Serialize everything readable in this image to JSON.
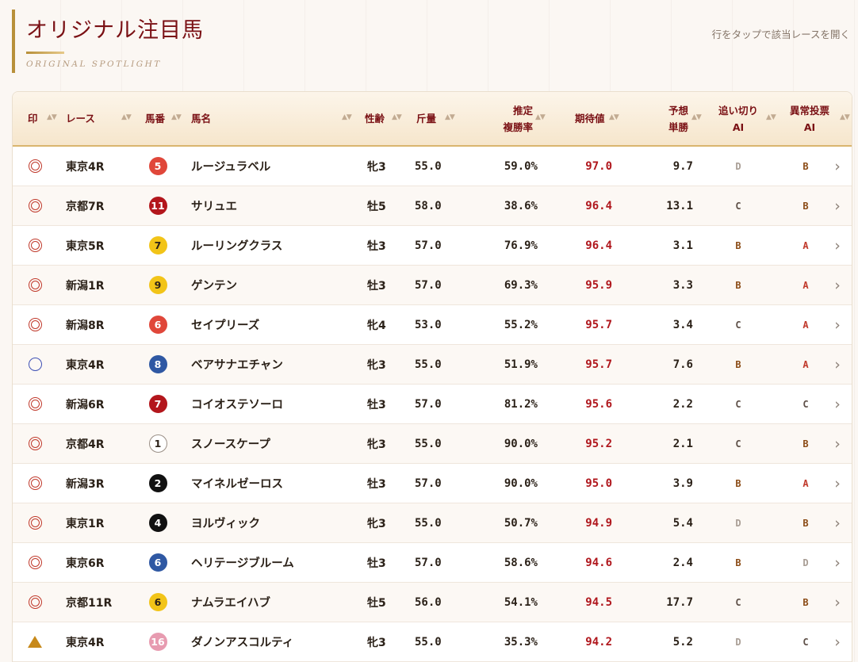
{
  "page": {
    "title": "オリジナル注目馬",
    "subtitle": "ORIGINAL SPOTLIGHT",
    "hint": "行をタップで該当レースを開く"
  },
  "table": {
    "headers": {
      "mark": "印",
      "race": "レース",
      "num": "馬番",
      "name": "馬名",
      "sexage": "性齢",
      "weight": "斤量",
      "rate_l1": "推定",
      "rate_l2": "複勝率",
      "ev": "期待値",
      "odds_l1": "予想",
      "odds_l2": "単勝",
      "ai1_l1": "追い切り",
      "ai1_l2": "AI",
      "ai2_l1": "異常投票",
      "ai2_l2": "AI"
    },
    "sort_icon": "sort-updown-icon",
    "rows": [
      {
        "mark": "double-circle",
        "race": "東京4R",
        "num": "5",
        "num_bg": "#e0473a",
        "num_fg": "#ffffff",
        "num_border": "#e0473a",
        "name": "ルージュラベル",
        "sexage": "牝3",
        "weight": "55.0",
        "rate": "59.0%",
        "ev": "97.0",
        "odds": "9.7",
        "ai1": "D",
        "ai2": "B"
      },
      {
        "mark": "double-circle",
        "race": "京都7R",
        "num": "11",
        "num_bg": "#b3161c",
        "num_fg": "#ffffff",
        "num_border": "#b3161c",
        "name": "サリュエ",
        "sexage": "牡5",
        "weight": "58.0",
        "rate": "38.6%",
        "ev": "96.4",
        "odds": "13.1",
        "ai1": "C",
        "ai2": "B"
      },
      {
        "mark": "double-circle",
        "race": "東京5R",
        "num": "7",
        "num_bg": "#f2c418",
        "num_fg": "#2b2118",
        "num_border": "#f2c418",
        "name": "ルーリングクラス",
        "sexage": "牡3",
        "weight": "57.0",
        "rate": "76.9%",
        "ev": "96.4",
        "odds": "3.1",
        "ai1": "B",
        "ai2": "A"
      },
      {
        "mark": "double-circle",
        "race": "新潟1R",
        "num": "9",
        "num_bg": "#f2c418",
        "num_fg": "#2b2118",
        "num_border": "#f2c418",
        "name": "ゲンテン",
        "sexage": "牡3",
        "weight": "57.0",
        "rate": "69.3%",
        "ev": "95.9",
        "odds": "3.3",
        "ai1": "B",
        "ai2": "A"
      },
      {
        "mark": "double-circle",
        "race": "新潟8R",
        "num": "6",
        "num_bg": "#e0473a",
        "num_fg": "#ffffff",
        "num_border": "#e0473a",
        "name": "セイプリーズ",
        "sexage": "牝4",
        "weight": "53.0",
        "rate": "55.2%",
        "ev": "95.7",
        "odds": "3.4",
        "ai1": "C",
        "ai2": "A"
      },
      {
        "mark": "single-circle",
        "race": "東京4R",
        "num": "8",
        "num_bg": "#2f58a3",
        "num_fg": "#ffffff",
        "num_border": "#2f58a3",
        "name": "ベアサナエチャン",
        "sexage": "牝3",
        "weight": "55.0",
        "rate": "51.9%",
        "ev": "95.7",
        "odds": "7.6",
        "ai1": "B",
        "ai2": "A"
      },
      {
        "mark": "double-circle",
        "race": "新潟6R",
        "num": "7",
        "num_bg": "#b3161c",
        "num_fg": "#ffffff",
        "num_border": "#b3161c",
        "name": "コイオステソーロ",
        "sexage": "牡3",
        "weight": "57.0",
        "rate": "81.2%",
        "ev": "95.6",
        "odds": "2.2",
        "ai1": "C",
        "ai2": "C"
      },
      {
        "mark": "double-circle",
        "race": "京都4R",
        "num": "1",
        "num_bg": "#ffffff",
        "num_fg": "#2b2118",
        "num_border": "#9a8f86",
        "name": "スノースケープ",
        "sexage": "牝3",
        "weight": "55.0",
        "rate": "90.0%",
        "ev": "95.2",
        "odds": "2.1",
        "ai1": "C",
        "ai2": "B"
      },
      {
        "mark": "double-circle",
        "race": "新潟3R",
        "num": "2",
        "num_bg": "#111111",
        "num_fg": "#ffffff",
        "num_border": "#111111",
        "name": "マイネルゼーロス",
        "sexage": "牡3",
        "weight": "57.0",
        "rate": "90.0%",
        "ev": "95.0",
        "odds": "3.9",
        "ai1": "B",
        "ai2": "A"
      },
      {
        "mark": "double-circle",
        "race": "東京1R",
        "num": "4",
        "num_bg": "#111111",
        "num_fg": "#ffffff",
        "num_border": "#111111",
        "name": "ヨルヴィック",
        "sexage": "牝3",
        "weight": "55.0",
        "rate": "50.7%",
        "ev": "94.9",
        "odds": "5.4",
        "ai1": "D",
        "ai2": "B"
      },
      {
        "mark": "double-circle",
        "race": "東京6R",
        "num": "6",
        "num_bg": "#2f58a3",
        "num_fg": "#ffffff",
        "num_border": "#2f58a3",
        "name": "ヘリテージブルーム",
        "sexage": "牡3",
        "weight": "57.0",
        "rate": "58.6%",
        "ev": "94.6",
        "odds": "2.4",
        "ai1": "B",
        "ai2": "D"
      },
      {
        "mark": "double-circle",
        "race": "京都11R",
        "num": "6",
        "num_bg": "#f2c418",
        "num_fg": "#2b2118",
        "num_border": "#f2c418",
        "name": "ナムラエイハブ",
        "sexage": "牡5",
        "weight": "56.0",
        "rate": "54.1%",
        "ev": "94.5",
        "odds": "17.7",
        "ai1": "C",
        "ai2": "B"
      },
      {
        "mark": "triangle",
        "race": "東京4R",
        "num": "16",
        "num_bg": "#e79bb0",
        "num_fg": "#ffffff",
        "num_border": "#e79bb0",
        "name": "ダノンアスコルティ",
        "sexage": "牝3",
        "weight": "55.0",
        "rate": "35.3%",
        "ev": "94.2",
        "odds": "5.2",
        "ai1": "D",
        "ai2": "C"
      }
    ]
  },
  "grade_colors": {
    "A": "#c0392b",
    "B": "#8a4a14",
    "C": "#5e5048",
    "D": "#a89d94"
  },
  "chevron_icon": "chevron-right-icon"
}
